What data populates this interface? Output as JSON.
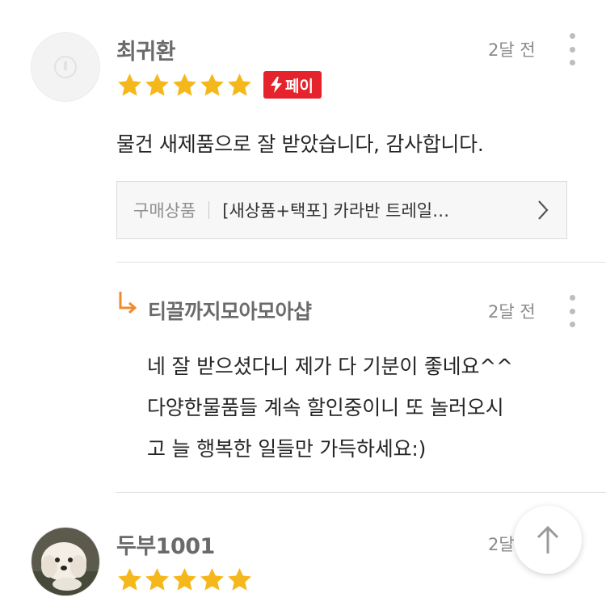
{
  "reviews": [
    {
      "author": "최귀환",
      "date": "2달 전",
      "rating": 5,
      "badge": {
        "label": "페이",
        "icon": "lightning-icon",
        "color": "#e4232d"
      },
      "text": "물건 새제품으로 잘 받았습니다, 감사합니다.",
      "product": {
        "label": "구매상품",
        "name": "[새상품+택포] 카라반 트레일…"
      },
      "reply": {
        "author": "티끌까지모아모아샵",
        "date": "2달 전",
        "lines": [
          "네 잘 받으셨다니 제가 다 기분이 좋네요^^",
          "다양한물품들 계속 할인중이니 또 놀러오시",
          "고 늘 행복한 일들만 가득하세요:)"
        ]
      }
    },
    {
      "author": "두부1001",
      "date": "2달",
      "rating": 5
    }
  ],
  "colors": {
    "star": "#f5b81c",
    "reply_arrow": "#f08a2c",
    "divider": "#e2e2e2"
  },
  "icons": {
    "more": "kebab-menu-icon",
    "chevron": "chevron-right-icon",
    "scroll_top": "arrow-up-icon",
    "reply": "reply-arrow-icon"
  }
}
